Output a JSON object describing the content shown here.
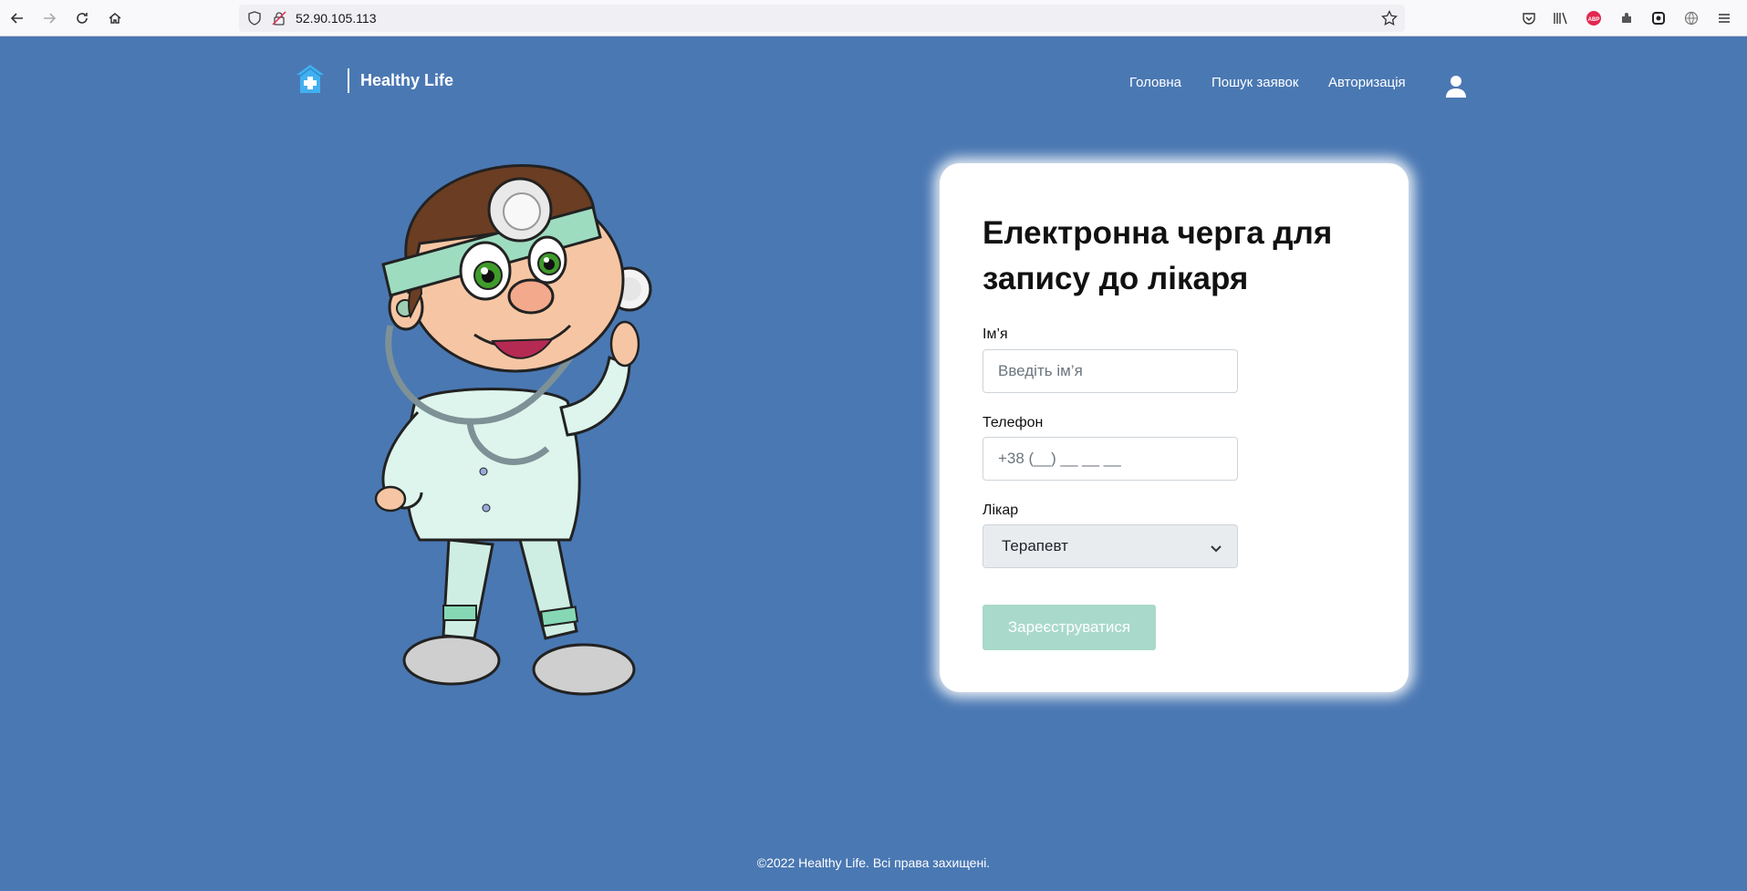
{
  "browser": {
    "url": "52.90.105.113"
  },
  "header": {
    "brand": "Healthy Life",
    "nav": [
      "Головна",
      "Пошук заявок",
      "Авторизація"
    ]
  },
  "form": {
    "title": "Електронна черга для запису до лікаря",
    "name_label": "Ім’я",
    "name_placeholder": "Введіть ім’я",
    "phone_label": "Телефон",
    "phone_placeholder": "+38 (__) __ __ __",
    "doctor_label": "Лікар",
    "doctor_value": "Терапевт",
    "submit": "Зареєструватися"
  },
  "footer": {
    "text": "©2022 Healthy Life. Всі права захищені."
  },
  "colors": {
    "background": "#4a78b3",
    "button": "#a9d9cb"
  }
}
